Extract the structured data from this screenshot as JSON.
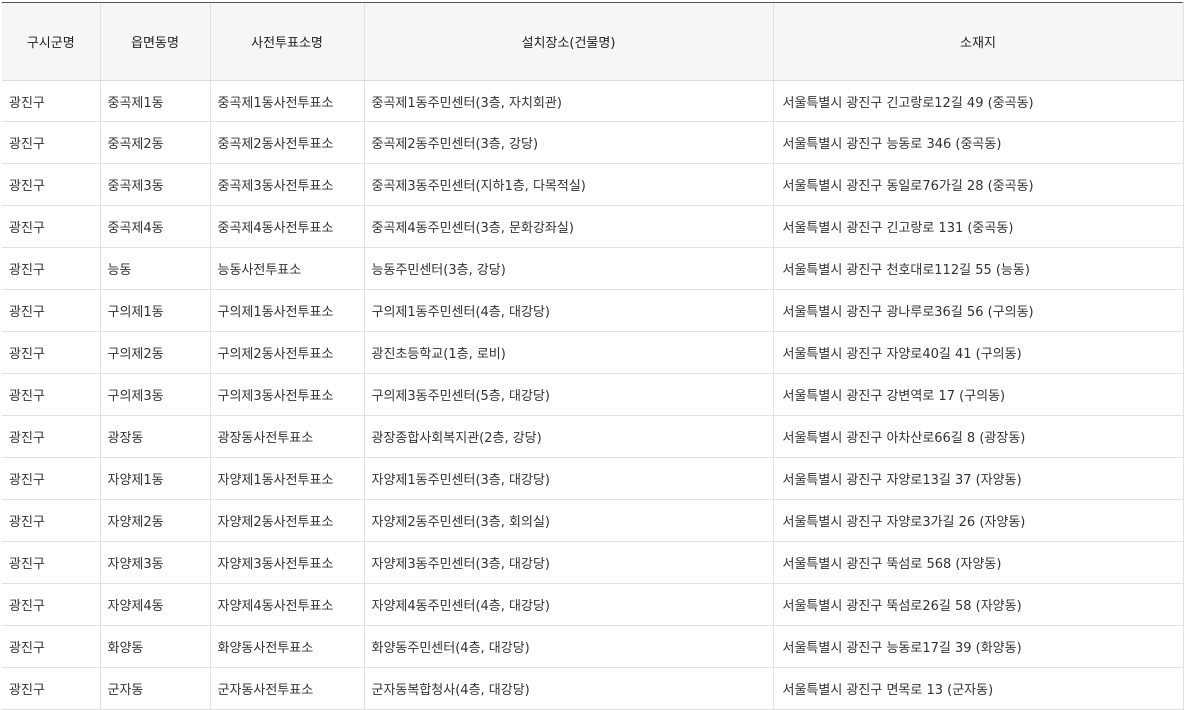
{
  "table": {
    "headers": [
      "구시군명",
      "읍면동명",
      "사전투표소명",
      "설치장소(건물명)",
      "소재지"
    ],
    "rows": [
      [
        "광진구",
        "중곡제1동",
        "중곡제1동사전투표소",
        "중곡제1동주민센터(3층, 자치회관)",
        "서울특별시 광진구 긴고랑로12길 49 (중곡동)"
      ],
      [
        "광진구",
        "중곡제2동",
        "중곡제2동사전투표소",
        "중곡제2동주민센터(3층, 강당)",
        "서울특별시 광진구 능동로 346 (중곡동)"
      ],
      [
        "광진구",
        "중곡제3동",
        "중곡제3동사전투표소",
        "중곡제3동주민센터(지하1층, 다목적실)",
        "서울특별시 광진구 동일로76가길 28 (중곡동)"
      ],
      [
        "광진구",
        "중곡제4동",
        "중곡제4동사전투표소",
        "중곡제4동주민센터(3층, 문화강좌실)",
        "서울특별시 광진구 긴고랑로 131 (중곡동)"
      ],
      [
        "광진구",
        "능동",
        "능동사전투표소",
        "능동주민센터(3층, 강당)",
        "서울특별시 광진구 천호대로112길 55 (능동)"
      ],
      [
        "광진구",
        "구의제1동",
        "구의제1동사전투표소",
        "구의제1동주민센터(4층, 대강당)",
        "서울특별시 광진구 광나루로36길 56 (구의동)"
      ],
      [
        "광진구",
        "구의제2동",
        "구의제2동사전투표소",
        "광진초등학교(1층, 로비)",
        "서울특별시 광진구 자양로40길 41 (구의동)"
      ],
      [
        "광진구",
        "구의제3동",
        "구의제3동사전투표소",
        "구의제3동주민센터(5층, 대강당)",
        "서울특별시 광진구 강변역로 17 (구의동)"
      ],
      [
        "광진구",
        "광장동",
        "광장동사전투표소",
        "광장종합사회복지관(2층, 강당)",
        "서울특별시 광진구 아차산로66길 8 (광장동)"
      ],
      [
        "광진구",
        "자양제1동",
        "자양제1동사전투표소",
        "자양제1동주민센터(3층, 대강당)",
        "서울특별시 광진구 자양로13길 37 (자양동)"
      ],
      [
        "광진구",
        "자양제2동",
        "자양제2동사전투표소",
        "자양제2동주민센터(3층, 회의실)",
        "서울특별시 광진구 자양로3가길 26 (자양동)"
      ],
      [
        "광진구",
        "자양제3동",
        "자양제3동사전투표소",
        "자양제3동주민센터(3층, 대강당)",
        "서울특별시 광진구 뚝섬로 568 (자양동)"
      ],
      [
        "광진구",
        "자양제4동",
        "자양제4동사전투표소",
        "자양제4동주민센터(4층, 대강당)",
        "서울특별시 광진구 뚝섬로26길 58 (자양동)"
      ],
      [
        "광진구",
        "화양동",
        "화양동사전투표소",
        "화양동주민센터(4층, 대강당)",
        "서울특별시 광진구 능동로17길 39 (화양동)"
      ],
      [
        "광진구",
        "군자동",
        "군자동사전투표소",
        "군자동복합청사(4층, 대강당)",
        "서울특별시 광진구 면목로 13 (군자동)"
      ]
    ]
  }
}
